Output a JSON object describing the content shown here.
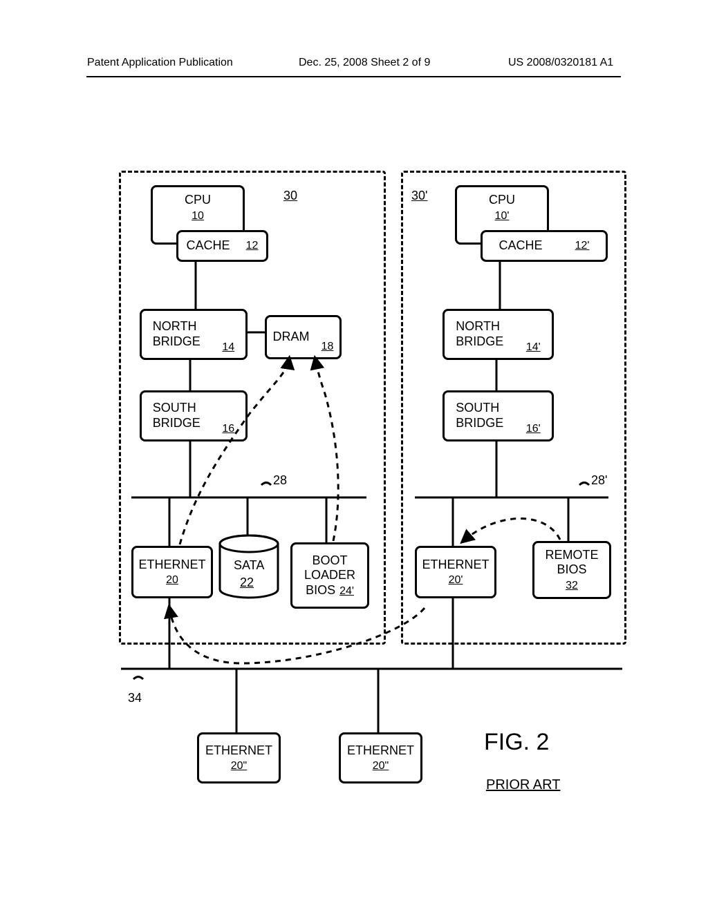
{
  "header": {
    "left": "Patent Application Publication",
    "center": "Dec. 25, 2008  Sheet 2 of 9",
    "right": "US 2008/0320181 A1"
  },
  "system30": {
    "ref": "30",
    "cpu": {
      "label": "CPU",
      "ref": "10"
    },
    "cache": {
      "label": "CACHE",
      "ref": "12"
    },
    "north": {
      "label1": "NORTH",
      "label2": "BRIDGE",
      "ref": "14"
    },
    "dram": {
      "label": "DRAM",
      "ref": "18"
    },
    "south": {
      "label1": "SOUTH",
      "label2": "BRIDGE",
      "ref": "16"
    },
    "bus": {
      "ref": "28"
    },
    "ethernet": {
      "label": "ETHERNET",
      "ref": "20"
    },
    "sata": {
      "label": "SATA",
      "ref": "22"
    },
    "boot": {
      "label1": "BOOT",
      "label2": "LOADER",
      "label3": "BIOS",
      "ref": "24'"
    }
  },
  "system30p": {
    "ref": "30'",
    "cpu": {
      "label": "CPU",
      "ref": "10'"
    },
    "cache": {
      "label": "CACHE",
      "ref": "12'"
    },
    "north": {
      "label1": "NORTH",
      "label2": "BRIDGE",
      "ref": "14'"
    },
    "south": {
      "label1": "SOUTH",
      "label2": "BRIDGE",
      "ref": "16'"
    },
    "bus": {
      "ref": "28'"
    },
    "ethernet": {
      "label": "ETHERNET",
      "ref": "20'"
    },
    "remote": {
      "label1": "REMOTE",
      "label2": "BIOS",
      "ref": "32"
    }
  },
  "network": {
    "ref": "34",
    "eth1": {
      "label": "ETHERNET",
      "ref": "20\""
    },
    "eth2": {
      "label": "ETHERNET",
      "ref": "20\""
    }
  },
  "figure": {
    "title": "FIG. 2",
    "subtitle": "PRIOR ART"
  }
}
